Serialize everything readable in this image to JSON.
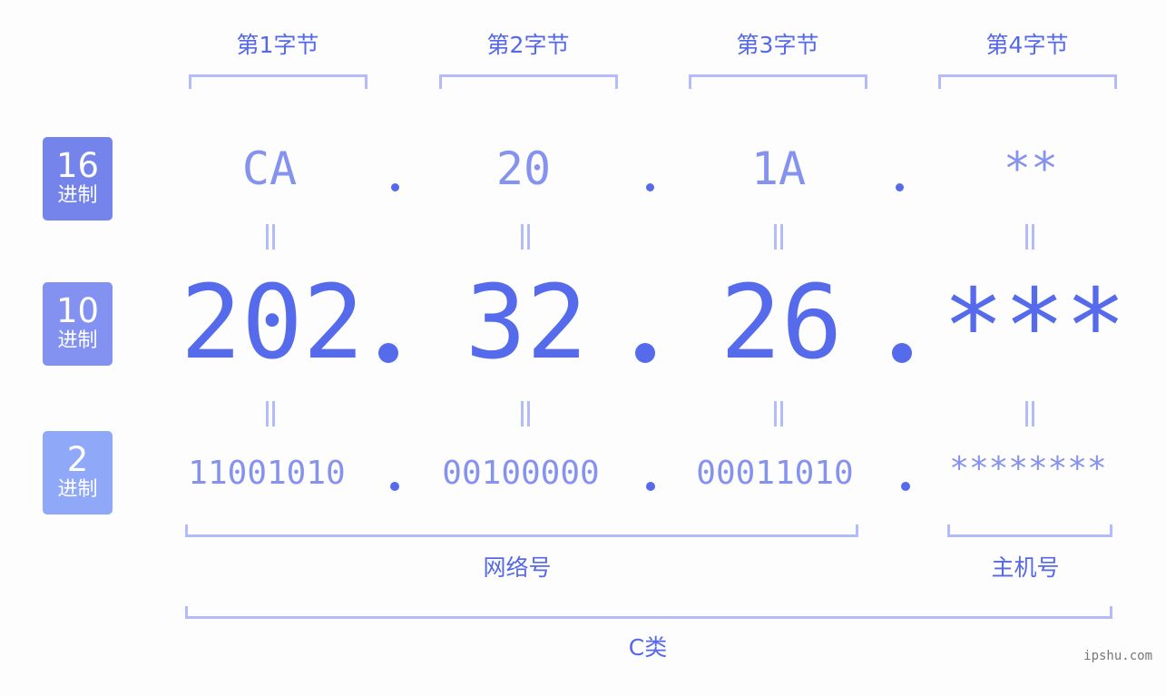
{
  "bytes": [
    {
      "label": "第1字节",
      "hex": "CA",
      "dec": "202",
      "bin": "11001010"
    },
    {
      "label": "第2字节",
      "hex": "20",
      "dec": "32",
      "bin": "00100000"
    },
    {
      "label": "第3字节",
      "hex": "1A",
      "dec": "26",
      "bin": "00011010"
    },
    {
      "label": "第4字节",
      "hex": "**",
      "dec": "***",
      "bin": "********"
    }
  ],
  "separator": ".",
  "radix_badges": [
    {
      "num": "16",
      "unit": "进制",
      "color": "#7484ea"
    },
    {
      "num": "10",
      "unit": "进制",
      "color": "#8392f0"
    },
    {
      "num": "2",
      "unit": "进制",
      "color": "#90a8f8"
    }
  ],
  "groups": {
    "network": "网络号",
    "host": "主机号",
    "class": "C类"
  },
  "watermark": "ipshu.com",
  "colors": {
    "primary": "#566bec",
    "light_value": "#8592ee",
    "bracket": "#b3bcf8",
    "background": "#fcfdfc"
  }
}
